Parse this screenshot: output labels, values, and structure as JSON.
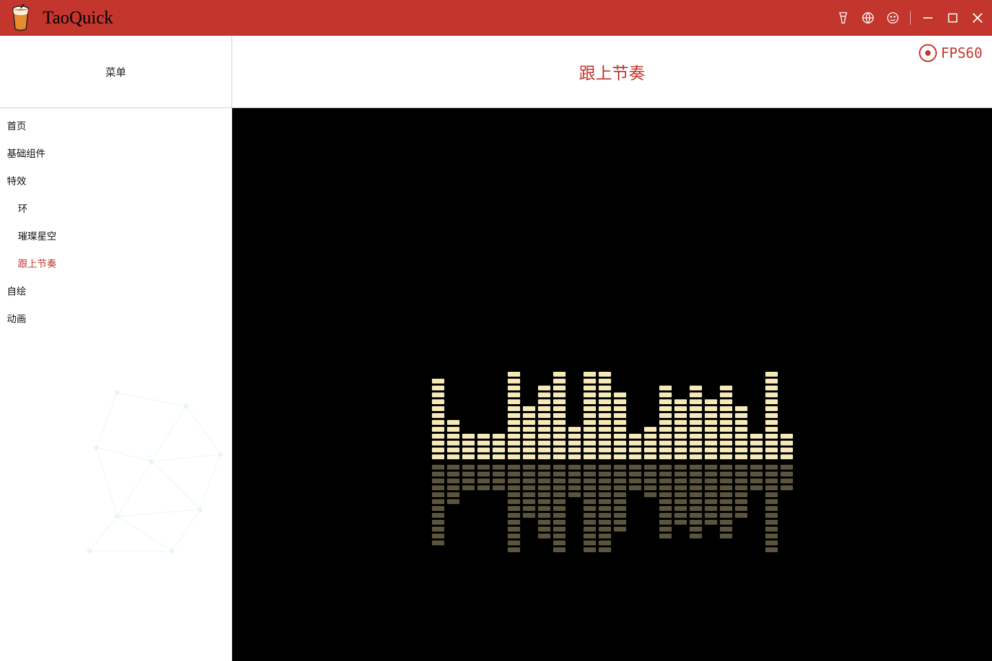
{
  "app": {
    "name": "TaoQuick"
  },
  "titlebar": {
    "icons": [
      "theme",
      "language",
      "about",
      "minimize",
      "maximize",
      "close"
    ]
  },
  "sidebar": {
    "header": "菜单",
    "items": [
      {
        "label": "首页",
        "kind": "item"
      },
      {
        "label": "基础组件",
        "kind": "item"
      },
      {
        "label": "特效",
        "kind": "item"
      },
      {
        "label": "环",
        "kind": "sub"
      },
      {
        "label": "璀璨星空",
        "kind": "sub"
      },
      {
        "label": "跟上节奏",
        "kind": "sub",
        "active": true
      },
      {
        "label": "自绘",
        "kind": "item"
      },
      {
        "label": "动画",
        "kind": "item"
      }
    ]
  },
  "content": {
    "title": "跟上节奏",
    "fps_label": "FPS60"
  },
  "equalizer": {
    "bars": [
      12,
      6,
      4,
      4,
      4,
      13,
      8,
      11,
      13,
      5,
      13,
      13,
      10,
      4,
      5,
      11,
      9,
      11,
      9,
      11,
      8,
      4,
      13,
      4
    ],
    "color_top": "#f5e9b8",
    "color_reflect": "#5a553c"
  }
}
